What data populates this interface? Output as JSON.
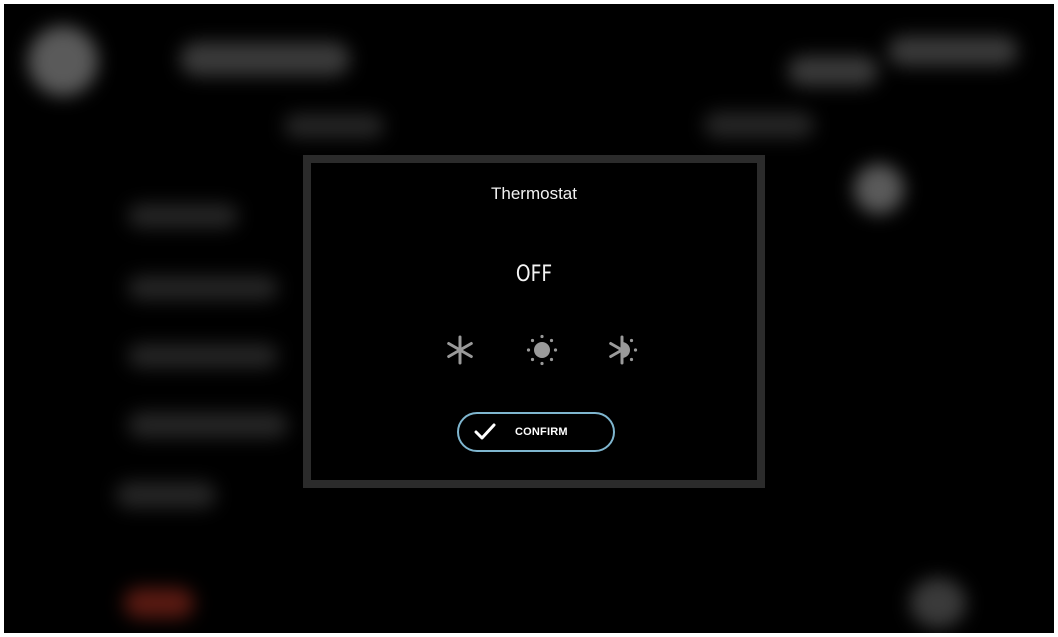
{
  "dialog": {
    "title": "Thermostat",
    "mode_value": "OFF",
    "modes": [
      {
        "icon": "snowflake-icon"
      },
      {
        "icon": "sun-icon"
      },
      {
        "icon": "auto-mode-icon"
      }
    ],
    "confirm": {
      "label": "CONFIRM",
      "icon": "checkmark-icon"
    }
  },
  "colors": {
    "background": "#000000",
    "dialog_border": "#2b2b2b",
    "confirm_border": "#7fb6cf",
    "icon": "#9a9a9a",
    "text": "#f2f2f2"
  }
}
